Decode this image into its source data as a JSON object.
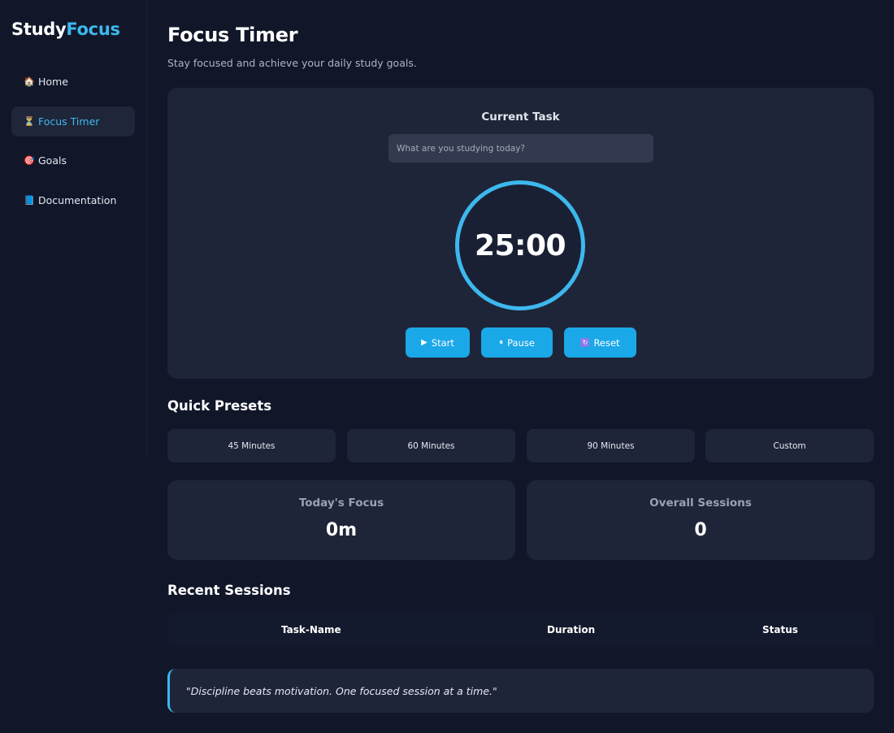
{
  "brand": {
    "part1": "Study",
    "part2": "Focus"
  },
  "sidebar": {
    "items": [
      {
        "icon": "🏠",
        "label": "Home"
      },
      {
        "icon": "⏳",
        "label": "Focus Timer"
      },
      {
        "icon": "🎯",
        "label": "Goals"
      },
      {
        "icon": "📘",
        "label": "Documentation"
      }
    ],
    "active": "Focus Timer"
  },
  "page": {
    "title": "Focus Timer",
    "subtitle": "Stay focused and achieve your daily study goals."
  },
  "timer": {
    "task_label": "Current Task",
    "task_value": "",
    "task_placeholder": "What are you studying today?",
    "time": "25:00",
    "start_icon": "▶",
    "start_label": "Start",
    "pause_icon": "⏸",
    "pause_label": "Pause",
    "reset_icon": "↻",
    "reset_label": "Reset"
  },
  "presets": {
    "title": "Quick Presets",
    "items": [
      "45 Minutes",
      "60 Minutes",
      "90 Minutes",
      "Custom"
    ]
  },
  "stats": {
    "today_label": "Today's Focus",
    "today_value": "0m",
    "overall_label": "Overall Sessions",
    "overall_value": "0"
  },
  "sessions": {
    "title": "Recent Sessions",
    "columns": [
      "Task-Name",
      "Duration",
      "Status"
    ],
    "rows": []
  },
  "quote": "\"Discipline beats motivation. One focused session at a time.\"",
  "colors": {
    "background": "#111729",
    "card": "#1f2538",
    "accent": "#3db8ee",
    "button": "#1aa8e8"
  }
}
